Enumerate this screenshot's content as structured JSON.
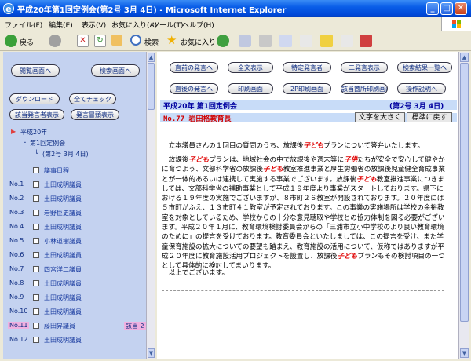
{
  "window": {
    "title": "平成20年第1回定例会(第2号 3月 4日) - Microsoft Internet Explorer"
  },
  "menu": [
    "ファイル(F)",
    "編集(E)",
    "表示(V)",
    "お気に入り(A)",
    "ツール(T)",
    "ヘルプ(H)"
  ],
  "toolbar": {
    "back": "戻る",
    "search": "検索",
    "favorites": "お気に入り"
  },
  "left": {
    "buttons": {
      "browse": "閲覧画面へ",
      "search": "検索画面へ",
      "download": "ダウンロード",
      "check_all": "全てチェック",
      "speaker_list": "該当発言者表示",
      "speaker_head": "発言冒頭表示"
    },
    "tree": {
      "year": "平成20年",
      "session": "第1回定例会",
      "issue": "(第2号 3月 4日)",
      "agenda": "議事日程"
    },
    "rows": [
      {
        "no": "No.1",
        "name": "土田成明議員",
        "hit": ""
      },
      {
        "no": "No.2",
        "name": "土田成明議員",
        "hit": ""
      },
      {
        "no": "No.3",
        "name": "岩野臣史議員",
        "hit": ""
      },
      {
        "no": "No.4",
        "name": "土田成明議員",
        "hit": ""
      },
      {
        "no": "No.5",
        "name": "小林道樹議員",
        "hit": ""
      },
      {
        "no": "No.6",
        "name": "土田成明議員",
        "hit": ""
      },
      {
        "no": "No.7",
        "name": "四宮洋二議員",
        "hit": ""
      },
      {
        "no": "No.8",
        "name": "土田成明議員",
        "hit": ""
      },
      {
        "no": "No.9",
        "name": "土田成明議員",
        "hit": ""
      },
      {
        "no": "No.10",
        "name": "土田成明議員",
        "hit": ""
      },
      {
        "no": "No.11",
        "name": "藤田昇議員",
        "hit": "該当 2"
      },
      {
        "no": "No.12",
        "name": "土田成明議員",
        "hit": ""
      }
    ]
  },
  "right": {
    "buttons": {
      "prev": "直前の発言へ",
      "full": "全文表示",
      "specific": "特定発言者",
      "twin": "二発言表示",
      "result_list": "検索結果一覧へ",
      "next": "直後の発言へ",
      "print": "印刷画面",
      "pdf": "2P印刷画面",
      "speaker_print": "該当箇所印刷画面",
      "operation": "操作説明へ"
    },
    "session_title": "平成20年 第1回定例会",
    "issue": "(第2号 3月 4日)",
    "speaker": "No.77 岩田格教育長",
    "text_large": "文字を大きく",
    "text_normal": "標準に戻す",
    "paragraphs": [
      [
        {
          "t": "　立本議員さんの１回目の質問のうち、放課後"
        },
        {
          "t": "子ども",
          "k": true
        },
        {
          "t": "プランについて答弁いたします。"
        }
      ],
      [
        {
          "t": "　放課後"
        },
        {
          "t": "子ども",
          "k": true
        },
        {
          "t": "プランは、地域社会の中で放課後や週末等に"
        },
        {
          "t": "子供",
          "k": true
        },
        {
          "t": "たちが安全で安心して健やかに育つよう、文部科学省の放課後"
        },
        {
          "t": "子ども",
          "k": true
        },
        {
          "t": "教室推進事業と厚生労働省の放課後児童健全育成事業とが一体的あるいは連携して実施する事業でございます。放課後"
        },
        {
          "t": "子ども",
          "k": true
        },
        {
          "t": "教室推進事業につきましては、文部科学省の補助事業として平成１９年度より事業がスタートしております。県下における１９年度の実施でございますが、８市町２６教室が開設されております。２０年度には５市町がふえ、１３市町４１教室が予定されております。この事業の実施場所は学校の余裕教室を対象としているため、学校からの十分な意見聴取や学校との協力体制を図る必要がございます。平成２０年１月に、教育環境検討委員会からの「三浦市立小中学校のより良い教育環境のために」の提言を受けております。教育委員会といたしましては、この提言を受け、また学童保育施設の拡大についての要望も踏まえ、教育施設の活用について、仮称ではありますが平成２０年度に教育施設活用プロジェクトを設置し、放課後"
        },
        {
          "t": "子ども",
          "k": true
        },
        {
          "t": "プランもその検討項目の一つとして具体的に検討してまいります。"
        }
      ],
      [
        {
          "t": "　以上でございます。"
        }
      ]
    ]
  },
  "colors": {
    "titlebar": "#0a5ee8",
    "left_bg": "#c4d2f0",
    "keyword": "#e00000",
    "highlight": "#f0b0e0"
  }
}
